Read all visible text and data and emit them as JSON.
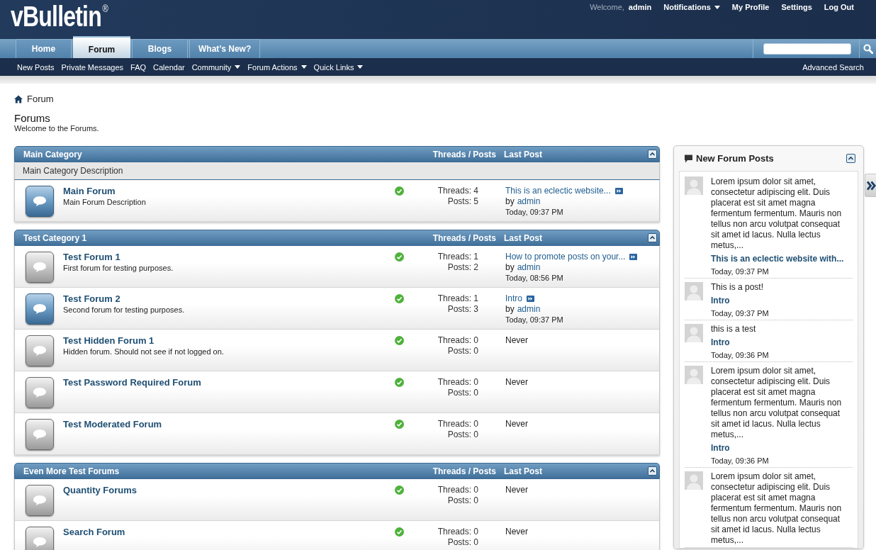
{
  "header": {
    "logo": "vBulletin$^{®}$",
    "welcome": "Welcome,",
    "username": "admin",
    "links": [
      {
        "label": "Notifications",
        "dropdown": true
      },
      {
        "label": "My Profile",
        "dropdown": false
      },
      {
        "label": "Settings",
        "dropdown": false
      },
      {
        "label": "Log Out",
        "dropdown": false
      }
    ]
  },
  "navbar": {
    "tabs": [
      {
        "label": "Home",
        "selected": false
      },
      {
        "label": "Forum",
        "selected": true
      },
      {
        "label": "Blogs",
        "selected": false
      },
      {
        "label": "What’s New?",
        "selected": false
      }
    ]
  },
  "subnav": {
    "links": [
      {
        "label": "New Posts",
        "dropdown": false
      },
      {
        "label": "Private Messages",
        "dropdown": false
      },
      {
        "label": "FAQ",
        "dropdown": false
      },
      {
        "label": "Calendar",
        "dropdown": false
      },
      {
        "label": "Community",
        "dropdown": true
      },
      {
        "label": "Forum Actions",
        "dropdown": true
      },
      {
        "label": "Quick Links",
        "dropdown": true
      }
    ],
    "advanced_search": "Advanced Search"
  },
  "breadcrumb": {
    "current": "Forum"
  },
  "page": {
    "title": "Forums",
    "subtitle": "Welcome to the Forums."
  },
  "categories": [
    {
      "title": "Main Category",
      "columns": [
        "Threads / Posts",
        "Last Post"
      ],
      "description": "Main Category Description",
      "forums": [
        {
          "title": "Main Forum",
          "description": "Main Forum Description",
          "unread": true,
          "threads": "Threads: 4",
          "posts": "Posts: 5",
          "last_post": {
            "kind": "post",
            "title": "This is an eclectic website...",
            "by": "by",
            "author": "admin",
            "time": "Today, 09:37 PM"
          }
        }
      ]
    },
    {
      "title": "Test Category 1",
      "columns": [
        "Threads / Posts",
        "Last Post"
      ],
      "forums": [
        {
          "title": "Test Forum 1",
          "description": "First forum for testing purposes.",
          "unread": false,
          "threads": "Threads: 1",
          "posts": "Posts: 2",
          "last_post": {
            "kind": "post",
            "title": "How to promote posts on your...",
            "by": "by",
            "author": "admin",
            "time": "Today, 08:56 PM"
          }
        },
        {
          "title": "Test Forum 2",
          "description": "Second forum for testing purposes.",
          "unread": true,
          "threads": "Threads: 1",
          "posts": "Posts: 3",
          "last_post": {
            "kind": "post",
            "title": "Intro",
            "by": "by",
            "author": "admin",
            "time": "Today, 09:37 PM"
          }
        },
        {
          "title": "Test Hidden Forum 1",
          "description": "Hidden forum. Should not see if not logged on.",
          "unread": false,
          "threads": "Threads: 0",
          "posts": "Posts: 0",
          "last_post": {
            "kind": "never",
            "text": "Never"
          }
        },
        {
          "title": "Test Password Required Forum",
          "unread": false,
          "threads": "Threads: 0",
          "posts": "Posts: 0",
          "last_post": {
            "kind": "never",
            "text": "Never"
          }
        },
        {
          "title": "Test Moderated Forum",
          "unread": false,
          "threads": "Threads: 0",
          "posts": "Posts: 0",
          "last_post": {
            "kind": "never",
            "text": "Never"
          }
        }
      ]
    },
    {
      "title": "Even More Test Forums",
      "columns": [
        "Threads / Posts",
        "Last Post"
      ],
      "forums": [
        {
          "title": "Quantity Forums",
          "unread": false,
          "threads": "Threads: 0",
          "posts": "Posts: 0",
          "last_post": {
            "kind": "never",
            "text": "Never"
          }
        },
        {
          "title": "Search Forum",
          "unread": false,
          "threads": "Threads: 0",
          "posts": "Posts: 0",
          "last_post": {
            "kind": "never",
            "text": "Never"
          }
        }
      ]
    }
  ],
  "sidebar": {
    "title": "New Forum Posts",
    "posts": [
      {
        "excerpt": "Lorem ipsum dolor sit amet, consectetur adipiscing elit. Duis placerat est sit amet magna fermentum fermentum. Mauris non tellus non arcu volutpat consequat sit amet id lacus. Nulla lectus metus,...",
        "thread": "This is an eclectic website with...",
        "time": "Today, 09:37 PM"
      },
      {
        "excerpt": "This is a post!",
        "thread": "Intro",
        "time": "Today, 09:37 PM"
      },
      {
        "excerpt": "this is a test",
        "thread": "Intro",
        "time": "Today, 09:36 PM"
      },
      {
        "excerpt": "Lorem ipsum dolor sit amet, consectetur adipiscing elit. Duis placerat est sit amet magna fermentum fermentum. Mauris non tellus non arcu volutpat consequat sit amet id lacus. Nulla lectus metus,...",
        "thread": "Intro",
        "time": "Today, 09:36 PM"
      },
      {
        "excerpt": "Lorem ipsum dolor sit amet, consectetur adipiscing elit. Duis placerat est sit amet magna fermentum fermentum. Mauris non tellus non arcu volutpat consequat sit amet id lacus. Nulla lectus metus,..."
      }
    ]
  }
}
